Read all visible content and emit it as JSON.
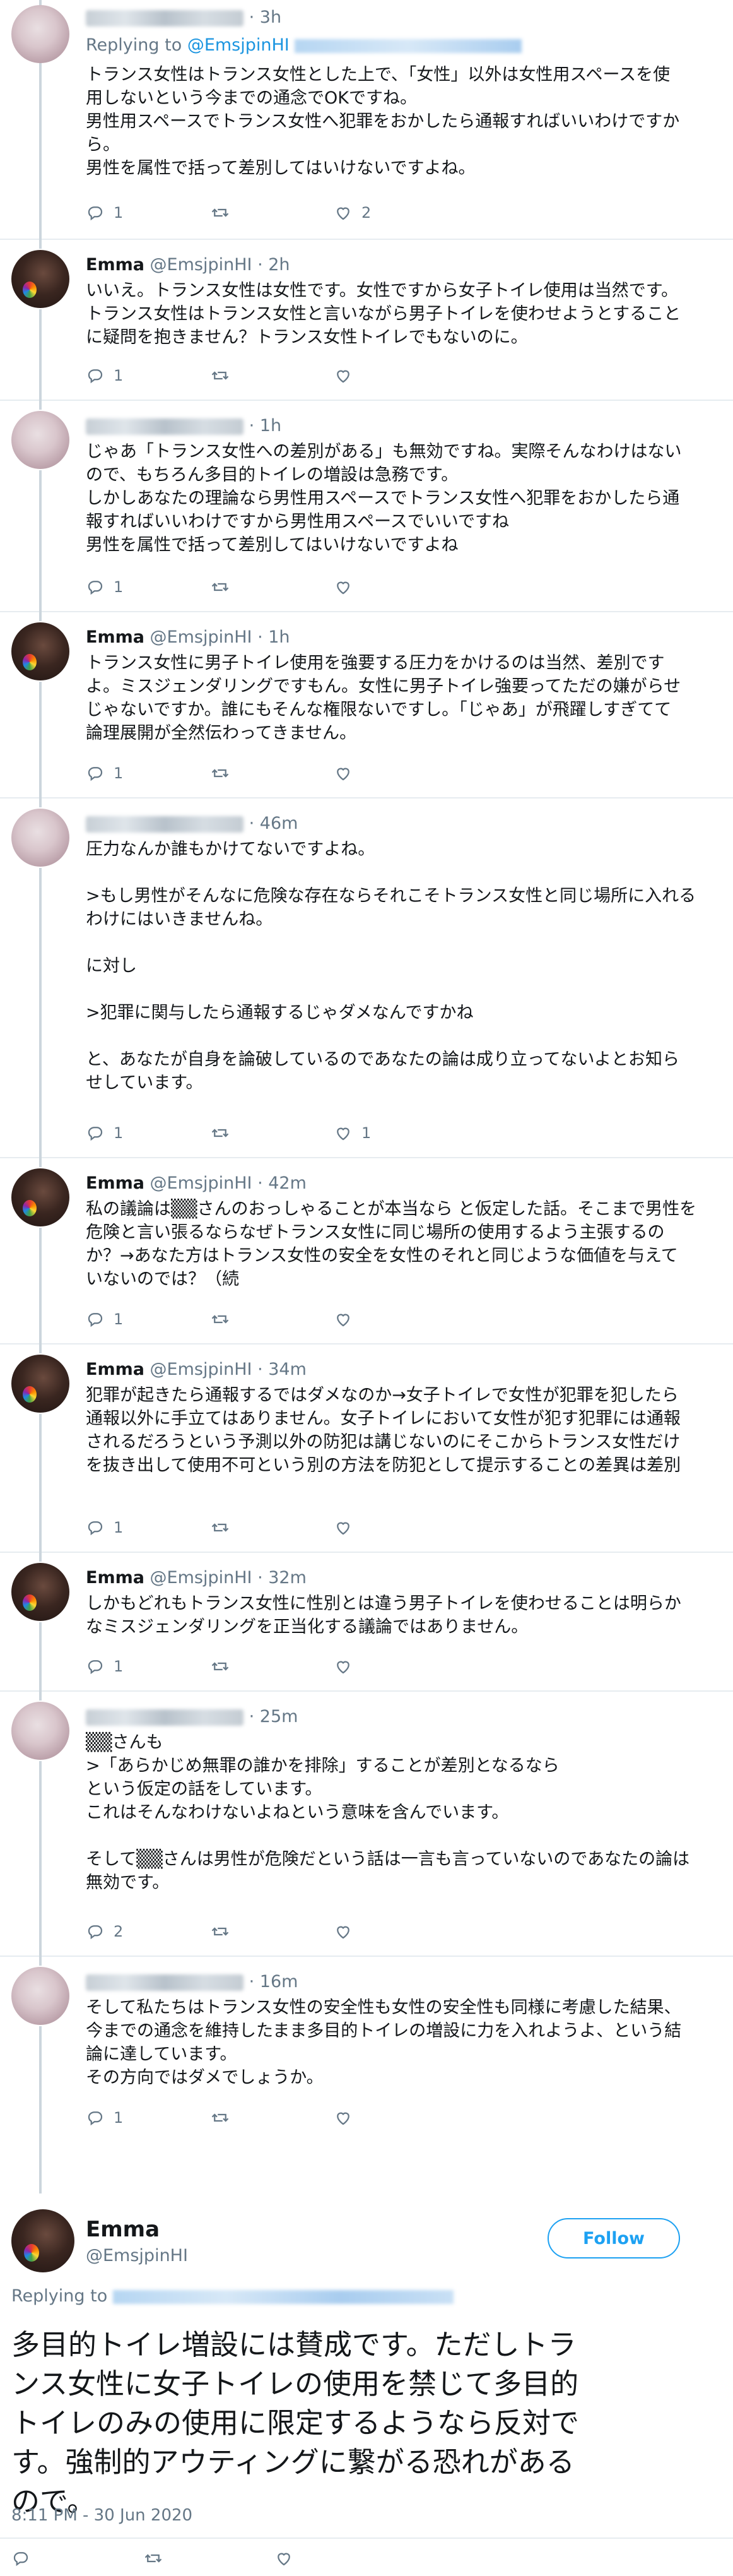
{
  "tweets": [
    {
      "user": "blurred",
      "time": "3h",
      "reply_label": "Replying to",
      "reply_to": "@EmsjpinHI",
      "text": "トランス女性はトランス女性とした上で、「女性」以外は女性用スペースを使\n用しないという今までの通念でOKですね。\n男性用スペースでトランス女性へ犯罪をおかしたら通報すればいいわけですか\nら。\n男性を属性で括って差別してはいけないですよね。",
      "replies": "1",
      "retweets": "",
      "likes": "2"
    },
    {
      "user": "emma",
      "name": "Emma",
      "handle": "@EmsjpinHI",
      "time": "2h",
      "text": "いいえ。トランス女性は女性です。女性ですから女子トイレ使用は当然です。\nトランス女性はトランス女性と言いながら男子トイレを使わせようとすること\nに疑問を抱きません？トランス女性トイレでもないのに。",
      "replies": "1",
      "retweets": "",
      "likes": ""
    },
    {
      "user": "blurred",
      "time": "1h",
      "text": "じゃあ「トランス女性への差別がある」も無効ですね。実際そんなわけはない\nので、もちろん多目的トイレの増設は急務です。\nしかしあなたの理論なら男性用スペースでトランス女性へ犯罪をおかしたら通\n報すればいいわけですから男性用スペースでいいですね\n男性を属性で括って差別してはいけないですよね",
      "replies": "1",
      "retweets": "",
      "likes": ""
    },
    {
      "user": "emma",
      "name": "Emma",
      "handle": "@EmsjpinHI",
      "time": "1h",
      "text": "トランス女性に男子トイレ使用を強要する圧力をかけるのは当然、差別です\nよ。ミスジェンダリングですもん。女性に男子トイレ強要ってただの嫌がらせ\nじゃないですか。誰にもそんな権限ないですし。「じゃあ」が飛躍しすぎてて\n論理展開が全然伝わってきません。",
      "replies": "1",
      "retweets": "",
      "likes": ""
    },
    {
      "user": "blurred",
      "time": "46m",
      "text": "圧力なんか誰もかけてないですよね。\n\n>もし男性がそんなに危険な存在ならそれこそトランス女性と同じ場所に入れる\nわけにはいきませんね。\n\nに対し\n\n>犯罪に関与したら通報するじゃダメなんですかね\n\nと、あなたが自身を論破しているのであなたの論は成り立ってないよとお知ら\nせしています。",
      "replies": "1",
      "retweets": "",
      "likes": "1"
    },
    {
      "user": "emma",
      "name": "Emma",
      "handle": "@EmsjpinHI",
      "time": "42m",
      "text": "私の議論は▒▒さんのおっしゃることが本当なら と仮定した話。そこまで男性を\n危険と言い張るならなぜトランス女性に同じ場所の使用するよう主張するの\nか？→あなた方はトランス女性の安全を女性のそれと同じような価値を与えて\nいないのでは？（続",
      "replies": "1",
      "retweets": "",
      "likes": ""
    },
    {
      "user": "emma",
      "name": "Emma",
      "handle": "@EmsjpinHI",
      "time": "34m",
      "text": "犯罪が起きたら通報するではダメなのか→女子トイレで女性が犯罪を犯したら\n通報以外に手立てはありません。女子トイレにおいて女性が犯す犯罪には通報\nされるだろうという予測以外の防犯は講じないのにそこからトランス女性だけ\nを抜き出して使用不可という別の方法を防犯として提示することの差異は差別",
      "replies": "1",
      "retweets": "",
      "likes": ""
    },
    {
      "user": "emma",
      "name": "Emma",
      "handle": "@EmsjpinHI",
      "time": "32m",
      "text": "しかもどれもトランス女性に性別とは違う男子トイレを使わせることは明らか\nなミスジェンダリングを正当化する議論ではありません。",
      "replies": "1",
      "retweets": "",
      "likes": ""
    },
    {
      "user": "blurred",
      "time": "25m",
      "text": "▒▒さんも\n>「あらかじめ無罪の誰かを排除」することが差別となるなら\nという仮定の話をしています。\nこれはそんなわけないよねという意味を含んでいます。\n\nそして▒▒さんは男性が危険だという話は一言も言っていないのであなたの論は\n無効です。",
      "replies": "2",
      "retweets": "",
      "likes": ""
    },
    {
      "user": "blurred",
      "time": "16m",
      "text": "そして私たちはトランス女性の安全性も女性の安全性も同様に考慮した結果、\n今までの通念を維持したまま多目的トイレの増設に力を入れようよ、という結\n論に達しています。\nその方向ではダメでしょうか。",
      "replies": "1",
      "retweets": "",
      "likes": ""
    }
  ],
  "main": {
    "name": "Emma",
    "handle": "@EmsjpinHI",
    "follow_label": "Follow",
    "reply_label": "Replying to",
    "text": "多目的トイレ増設には賛成です。ただしトラ\nンス女性に女子トイレの使用を禁じて多目的\nトイレのみの使用に限定するようなら反対で\nす。強制的アウティングに繋がる恐れがある\nので。",
    "timestamp": "8:11 PM - 30 Jun 2020"
  },
  "icons": {
    "reply": "reply-icon",
    "retweet": "retweet-icon",
    "like": "heart-icon"
  },
  "colors": {
    "link": "#1b95e0",
    "secondary": "#657786",
    "follow": "#1da1f2",
    "border": "#e6ecf0"
  }
}
